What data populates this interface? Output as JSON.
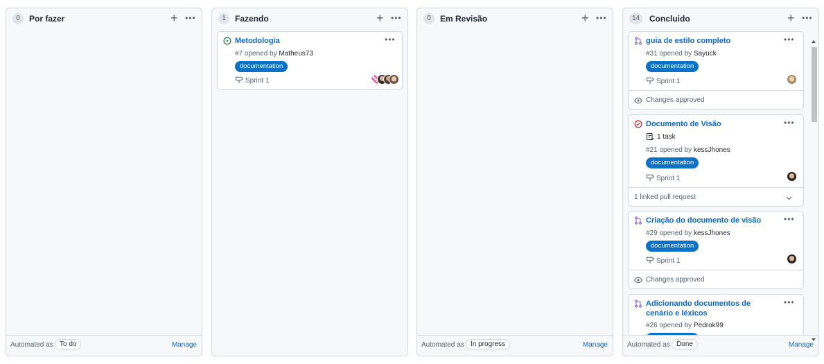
{
  "columns": [
    {
      "count": "0",
      "title": "Por fazer",
      "footer": {
        "automated_as": "Automated as",
        "badge": "To do",
        "manage": "Manage"
      }
    },
    {
      "count": "1",
      "title": "Fazendo",
      "cards": [
        {
          "title": "Metodologia",
          "number": "#7 opened by",
          "user": "Matheus73",
          "label": "documentation",
          "sprint": "Sprint 1"
        }
      ]
    },
    {
      "count": "0",
      "title": "Em Revisão",
      "footer": {
        "automated_as": "Automated as",
        "badge": "In progress",
        "manage": "Manage"
      }
    },
    {
      "count": "14",
      "title": "Concluido",
      "footer": {
        "automated_as": "Automated as",
        "badge": "Done",
        "manage": "Manage"
      },
      "cards": [
        {
          "title": "guia de estilo completo",
          "number": "#31 opened by",
          "user": "Sayuck",
          "label": "documentation",
          "sprint": "Sprint 1",
          "review": "Changes approved"
        },
        {
          "title": "Documento de Visão",
          "tasks": "1 task",
          "number": "#21 opened by",
          "user": "kessJhones",
          "label": "documentation",
          "sprint": "Sprint 1",
          "linked": "1 linked pull request"
        },
        {
          "title": "Criação do documento de visão",
          "number": "#29 opened by",
          "user": "kessJhones",
          "label": "documentation",
          "sprint": "Sprint 1",
          "review": "Changes approved"
        },
        {
          "title_line1": "Adicionando documentos de",
          "title_line2": "cenário e léxicos",
          "number": "#26 opened by",
          "user": "Pedrok99",
          "label": "documentation"
        }
      ]
    }
  ],
  "colors": {
    "link": "#0969da",
    "label_bg": "#0b72c5",
    "pr_icon": "#8250df",
    "open_icon": "#1a7f37",
    "closed_icon": "#cf222e"
  },
  "icons": [
    "plus-icon",
    "more-icon",
    "issue-open-icon",
    "issue-closed-icon",
    "pull-request-icon",
    "milestone-icon",
    "eye-icon",
    "tasklist-icon",
    "chevron-down-icon"
  ]
}
